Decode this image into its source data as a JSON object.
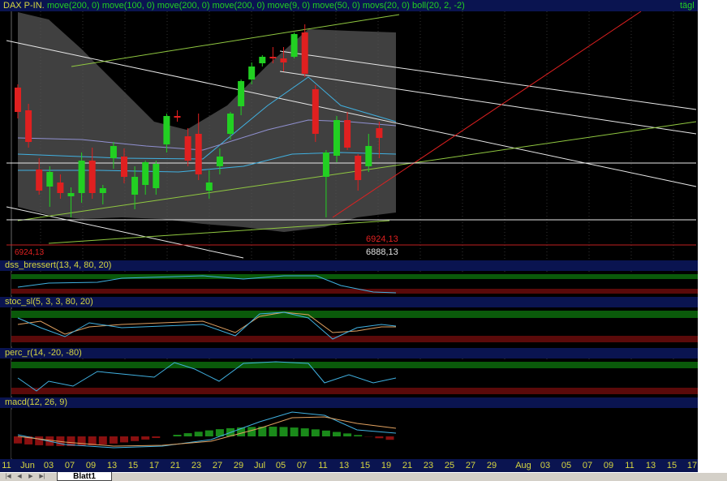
{
  "title": {
    "symbol": "DAX P-IN.",
    "indicators": "move(200, 0) move(100, 0) move(200, 0) move(200, 0) move(9, 0) move(50, 0) movs(20, 0) boll(20, 2, -2)",
    "period": "tägl"
  },
  "price_labels": {
    "red_value": "6924,13",
    "white_value": "6888,13",
    "left_red": "6924,13"
  },
  "panes": {
    "dss": "dss_bressert(13, 4, 80, 20)",
    "stoc": "stoc_sl(5, 3, 3, 80, 20)",
    "perc": "perc_r(14, -20, -80)",
    "macd": "macd(12, 26, 9)"
  },
  "dates": [
    "11",
    "Jun",
    "03",
    "07",
    "09",
    "13",
    "15",
    "17",
    "21",
    "23",
    "27",
    "29",
    "Jul",
    "05",
    "07",
    "11",
    "13",
    "15",
    "19",
    "21",
    "23",
    "25",
    "27",
    "29",
    "Aug",
    "03",
    "05",
    "07",
    "09",
    "11",
    "13",
    "15",
    "17"
  ],
  "sheet_tab": "Blatt1",
  "colors": {
    "up": "#22d022",
    "down": "#e02020",
    "background": "#000000",
    "title_bar": "#0a1450"
  },
  "chart_data": {
    "type": "candlestick",
    "candles": [
      {
        "o": 108,
        "h": 104,
        "l": 146,
        "c": 138
      },
      {
        "o": 136,
        "h": 128,
        "l": 182,
        "c": 175
      },
      {
        "o": 209,
        "h": 195,
        "l": 240,
        "c": 235
      },
      {
        "o": 230,
        "h": 205,
        "l": 255,
        "c": 212
      },
      {
        "o": 225,
        "h": 215,
        "l": 245,
        "c": 238
      },
      {
        "o": 242,
        "h": 231,
        "l": 268,
        "c": 238
      },
      {
        "o": 238,
        "h": 188,
        "l": 250,
        "c": 198
      },
      {
        "o": 198,
        "h": 182,
        "l": 245,
        "c": 238
      },
      {
        "o": 238,
        "h": 228,
        "l": 252,
        "c": 232
      },
      {
        "o": 195,
        "h": 175,
        "l": 208,
        "c": 180
      },
      {
        "o": 193,
        "h": 183,
        "l": 226,
        "c": 218
      },
      {
        "o": 240,
        "h": 205,
        "l": 258,
        "c": 218
      },
      {
        "o": 228,
        "h": 198,
        "l": 240,
        "c": 200
      },
      {
        "o": 232,
        "h": 198,
        "l": 240,
        "c": 202
      },
      {
        "o": 178,
        "h": 140,
        "l": 188,
        "c": 143
      },
      {
        "o": 143,
        "h": 136,
        "l": 150,
        "c": 145
      },
      {
        "o": 168,
        "h": 158,
        "l": 205,
        "c": 198
      },
      {
        "o": 165,
        "h": 140,
        "l": 222,
        "c": 215
      },
      {
        "o": 235,
        "h": 210,
        "l": 245,
        "c": 225
      },
      {
        "o": 205,
        "h": 183,
        "l": 215,
        "c": 193
      },
      {
        "o": 165,
        "h": 138,
        "l": 172,
        "c": 140
      },
      {
        "o": 131,
        "h": 98,
        "l": 142,
        "c": 100
      },
      {
        "o": 98,
        "h": 77,
        "l": 104,
        "c": 82
      },
      {
        "o": 78,
        "h": 68,
        "l": 82,
        "c": 70
      },
      {
        "o": 70,
        "h": 58,
        "l": 78,
        "c": 72
      },
      {
        "o": 72,
        "h": 58,
        "l": 88,
        "c": 77
      },
      {
        "o": 70,
        "h": 40,
        "l": 72,
        "c": 42
      },
      {
        "o": 40,
        "h": 30,
        "l": 95,
        "c": 91
      },
      {
        "o": 110,
        "h": 105,
        "l": 175,
        "c": 165
      },
      {
        "o": 218,
        "h": 185,
        "l": 268,
        "c": 188
      },
      {
        "o": 192,
        "h": 143,
        "l": 200,
        "c": 148
      },
      {
        "o": 148,
        "h": 138,
        "l": 185,
        "c": 182
      },
      {
        "o": 192,
        "h": 190,
        "l": 235,
        "c": 222
      },
      {
        "o": 205,
        "h": 165,
        "l": 212,
        "c": 180
      },
      {
        "o": 158,
        "h": 150,
        "l": 195,
        "c": 170
      }
    ]
  }
}
